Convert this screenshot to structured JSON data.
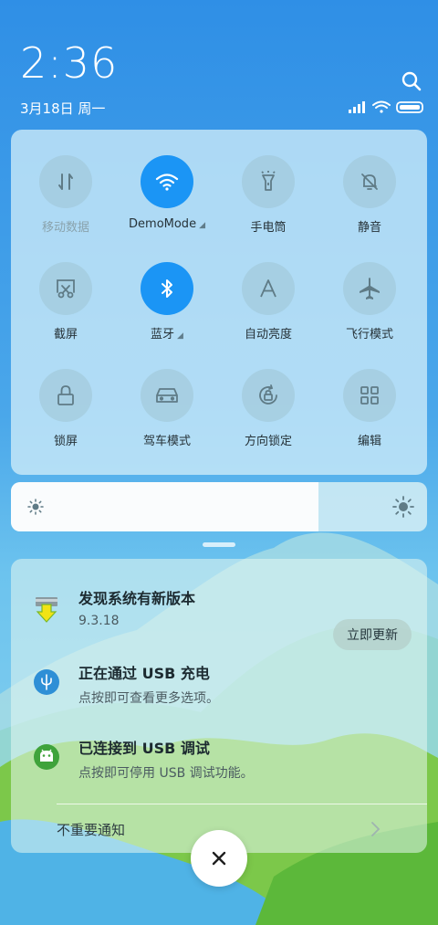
{
  "status": {
    "time": "2:36",
    "date": "3月18日 周一"
  },
  "quick_settings": {
    "tiles": [
      {
        "label": "移动数据",
        "icon": "mobile-data-icon",
        "active": false,
        "dim": true
      },
      {
        "label": "DemoMode",
        "icon": "wifi-icon",
        "active": true,
        "expandable": true
      },
      {
        "label": "手电筒",
        "icon": "flashlight-icon",
        "active": false
      },
      {
        "label": "静音",
        "icon": "mute-bell-icon",
        "active": false
      },
      {
        "label": "截屏",
        "icon": "screenshot-icon",
        "active": false
      },
      {
        "label": "蓝牙",
        "icon": "bluetooth-icon",
        "active": true,
        "expandable": true
      },
      {
        "label": "自动亮度",
        "icon": "auto-brightness-icon",
        "active": false
      },
      {
        "label": "飞行模式",
        "icon": "airplane-icon",
        "active": false
      },
      {
        "label": "锁屏",
        "icon": "lock-icon",
        "active": false
      },
      {
        "label": "驾车模式",
        "icon": "car-icon",
        "active": false
      },
      {
        "label": "方向锁定",
        "icon": "rotation-lock-icon",
        "active": false
      },
      {
        "label": "编辑",
        "icon": "grid-edit-icon",
        "active": false
      }
    ],
    "expand_marker": "◢"
  },
  "brightness": {
    "level": 0.74
  },
  "notifications": {
    "items": [
      {
        "title": "发现系统有新版本",
        "subtitle": "9.3.18",
        "icon": "update-download-icon",
        "action": "立即更新"
      },
      {
        "title": "正在通过  USB  充电",
        "subtitle": "点按即可查看更多选项。",
        "icon": "usb-icon"
      },
      {
        "title": "已连接到  USB  调试",
        "subtitle": "点按即可停用 USB 调试功能。",
        "icon": "android-debug-icon"
      }
    ],
    "unimportant_label": "不重要通知"
  },
  "colors": {
    "accent": "#1b95f5",
    "tile_inactive": "#9ec4d4"
  }
}
